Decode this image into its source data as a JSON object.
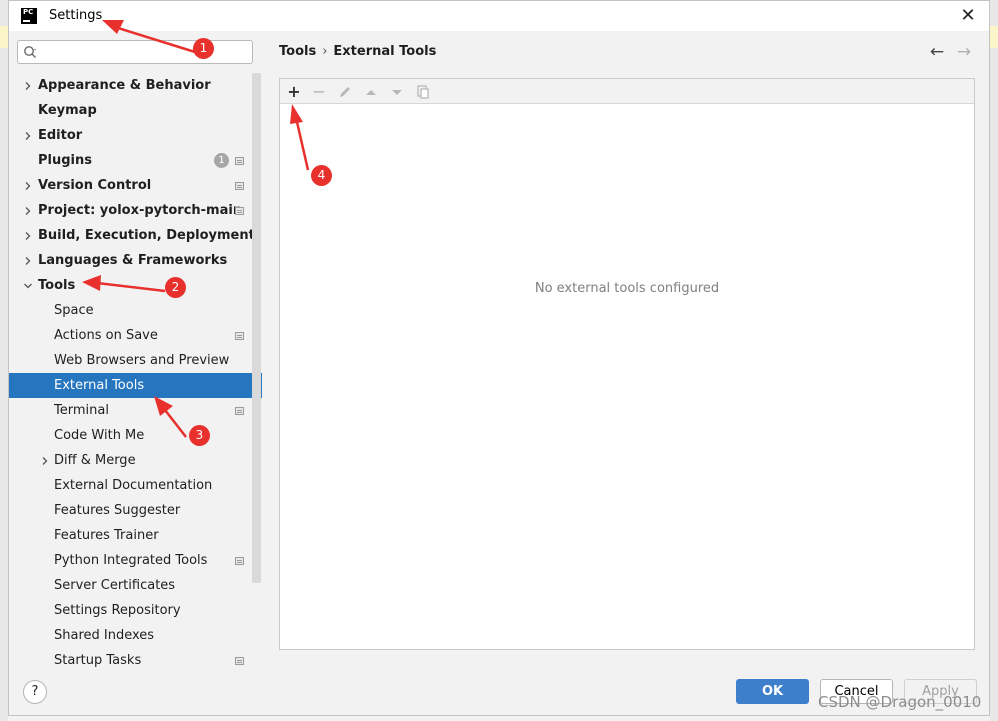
{
  "window": {
    "title": "Settings",
    "close_label": "✕",
    "app_logo_text": "PC"
  },
  "search": {
    "placeholder": "",
    "value": ""
  },
  "sidebar": {
    "items": [
      {
        "label": "Appearance & Behavior",
        "level": 0,
        "expander": "collapsed"
      },
      {
        "label": "Keymap",
        "level": 0,
        "expander": "none"
      },
      {
        "label": "Editor",
        "level": 0,
        "expander": "collapsed"
      },
      {
        "label": "Plugins",
        "level": 0,
        "expander": "none",
        "badge": "1",
        "project_icon": true
      },
      {
        "label": "Version Control",
        "level": 0,
        "expander": "collapsed",
        "project_icon": true
      },
      {
        "label": "Project: yolox-pytorch-main",
        "level": 0,
        "expander": "collapsed",
        "project_icon": true
      },
      {
        "label": "Build, Execution, Deployment",
        "level": 0,
        "expander": "collapsed"
      },
      {
        "label": "Languages & Frameworks",
        "level": 0,
        "expander": "collapsed"
      },
      {
        "label": "Tools",
        "level": 0,
        "expander": "expanded"
      },
      {
        "label": "Space",
        "level": 1,
        "expander": "none"
      },
      {
        "label": "Actions on Save",
        "level": 1,
        "expander": "none",
        "project_icon": true
      },
      {
        "label": "Web Browsers and Preview",
        "level": 1,
        "expander": "none"
      },
      {
        "label": "External Tools",
        "level": 1,
        "expander": "none",
        "selected": true
      },
      {
        "label": "Terminal",
        "level": 1,
        "expander": "none",
        "project_icon": true
      },
      {
        "label": "Code With Me",
        "level": 1,
        "expander": "none"
      },
      {
        "label": "Diff & Merge",
        "level": 1,
        "expander": "collapsed"
      },
      {
        "label": "External Documentation",
        "level": 1,
        "expander": "none"
      },
      {
        "label": "Features Suggester",
        "level": 1,
        "expander": "none"
      },
      {
        "label": "Features Trainer",
        "level": 1,
        "expander": "none"
      },
      {
        "label": "Python Integrated Tools",
        "level": 1,
        "expander": "none",
        "project_icon": true
      },
      {
        "label": "Server Certificates",
        "level": 1,
        "expander": "none"
      },
      {
        "label": "Settings Repository",
        "level": 1,
        "expander": "none"
      },
      {
        "label": "Shared Indexes",
        "level": 1,
        "expander": "none"
      },
      {
        "label": "Startup Tasks",
        "level": 1,
        "expander": "none",
        "project_icon": true
      }
    ]
  },
  "breadcrumb": {
    "parent": "Tools",
    "separator": "›",
    "current": "External Tools"
  },
  "nav": {
    "back": "←",
    "forward": "→"
  },
  "toolbar": {
    "add": "+",
    "remove": "−",
    "edit_icon": "pencil-icon",
    "up_icon": "triangle-up-icon",
    "down_icon": "triangle-down-icon",
    "copy_icon": "copy-icon"
  },
  "main": {
    "empty_text": "No external tools configured"
  },
  "footer": {
    "help": "?",
    "ok": "OK",
    "cancel": "Cancel",
    "apply": "Apply"
  },
  "annotations": {
    "markers": [
      "1",
      "2",
      "3",
      "4"
    ],
    "color": "#e8302c",
    "watermark": "CSDN @Dragon_0010"
  },
  "colors": {
    "selection": "#2675bf",
    "ok_button": "#3d7fca",
    "marker": "#e8302c"
  }
}
